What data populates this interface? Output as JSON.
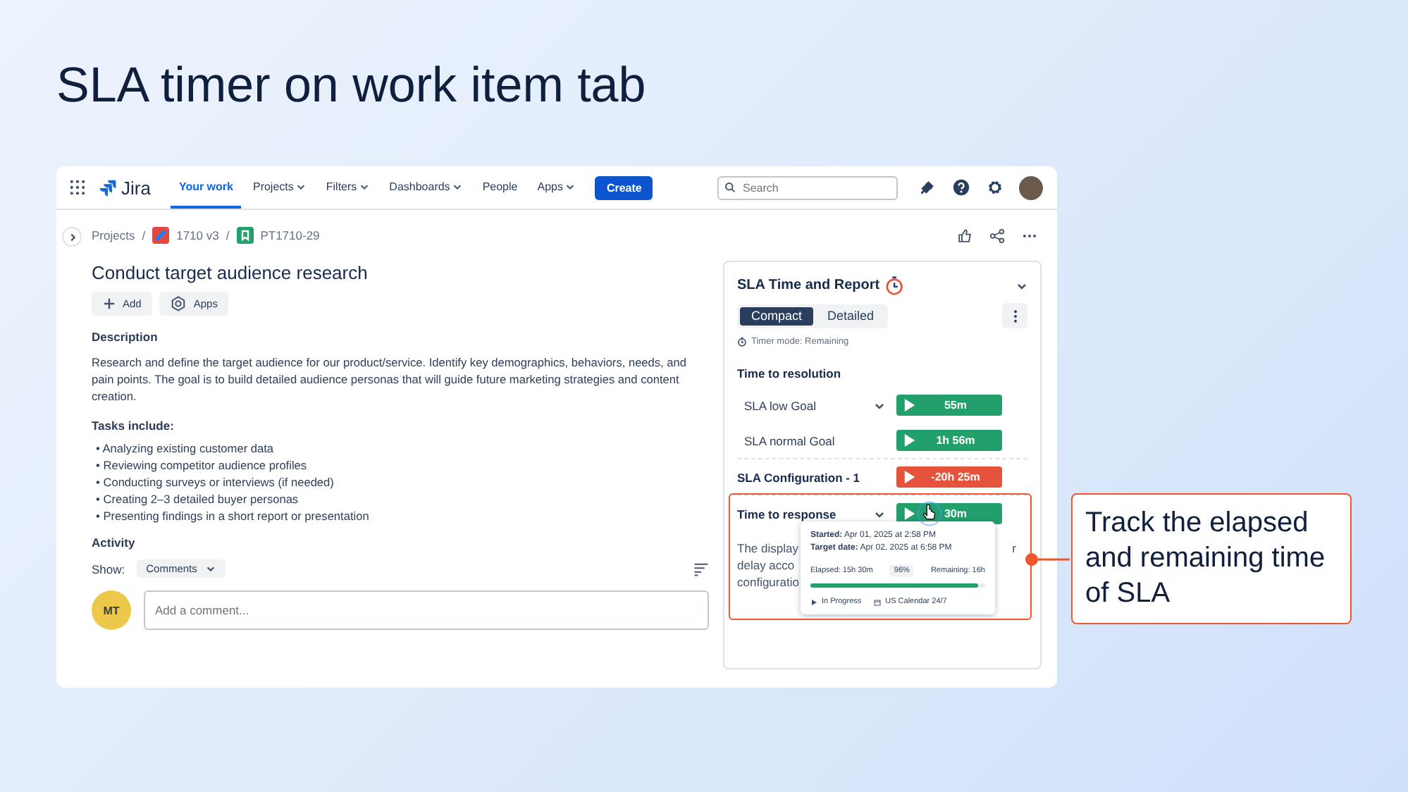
{
  "slide": {
    "title": "SLA timer on work item tab",
    "callout": "Track the elapsed and remaining time of SLA"
  },
  "nav": {
    "product": "Jira",
    "items": [
      {
        "label": "Your work",
        "selected": true,
        "has_menu": false
      },
      {
        "label": "Projects",
        "selected": false,
        "has_menu": true
      },
      {
        "label": "Filters",
        "selected": false,
        "has_menu": true
      },
      {
        "label": "Dashboards",
        "selected": false,
        "has_menu": true
      },
      {
        "label": "People",
        "selected": false,
        "has_menu": false
      },
      {
        "label": "Apps",
        "selected": false,
        "has_menu": true
      }
    ],
    "create": "Create",
    "search": {
      "placeholder": "Search"
    }
  },
  "breadcrumbs": [
    "Projects",
    "1710 v3",
    "PT1710-29"
  ],
  "breadcrumb_separator": "/",
  "issue": {
    "title": "Conduct target audience research",
    "actions": [
      "Add",
      "Apps"
    ],
    "description_heading": "Description",
    "description": "Research and define the target audience for our product/service. Identify key demographics, behaviors, needs, and pain points. The goal is to build detailed audience personas that will guide future marketing strategies and content creation.",
    "tasks_heading": "Tasks include:",
    "tasks": [
      "• Analyzing existing customer data",
      "• Reviewing competitor audience profiles",
      "• Conducting surveys or interviews (if needed)",
      "• Creating 2–3 detailed buyer personas",
      "• Presenting findings in a short report or presentation"
    ],
    "activity_heading": "Activity",
    "show_label": "Show:",
    "show_value": "Comments",
    "avatar": "MT",
    "comment_placeholder": "Add a comment..."
  },
  "sla": {
    "title": "SLA Time and Report",
    "tabs": [
      {
        "label": "Compact",
        "selected": true
      },
      {
        "label": "Detailed",
        "selected": false
      }
    ],
    "timer_mode": "Timer mode: Remaining",
    "rows": [
      {
        "kind": "heading",
        "name": "Time to resolution"
      },
      {
        "kind": "goal",
        "name": "SLA low Goal",
        "has_menu": true,
        "value": "55m",
        "color": "#22a06b"
      },
      {
        "kind": "goal",
        "name": "SLA normal Goal",
        "has_menu": false,
        "value": "1h 56m",
        "color": "#22a06b"
      },
      {
        "kind": "group",
        "name": "SLA Configuration - 1",
        "has_menu": false,
        "value": "-20h 25m",
        "color": "#e5533c"
      },
      {
        "kind": "group",
        "name": "Time to response",
        "has_menu": true,
        "value": "30m",
        "color": "#22a06b"
      }
    ],
    "note_lines": [
      "The display",
      "delay acco",
      "configuratio"
    ],
    "note_tail": "r",
    "tooltip": {
      "started_label": "Started:",
      "started": "Apr 01, 2025 at 2:58 PM",
      "target_label": "Target date:",
      "target": "Apr 02, 2025 at 6:58 PM",
      "elapsed": "Elapsed: 15h 30m",
      "percent": "96%",
      "remaining": "Remaining: 16h",
      "level": 0.96,
      "status": "In Progress",
      "calendar": "US Calendar 24/7"
    }
  }
}
